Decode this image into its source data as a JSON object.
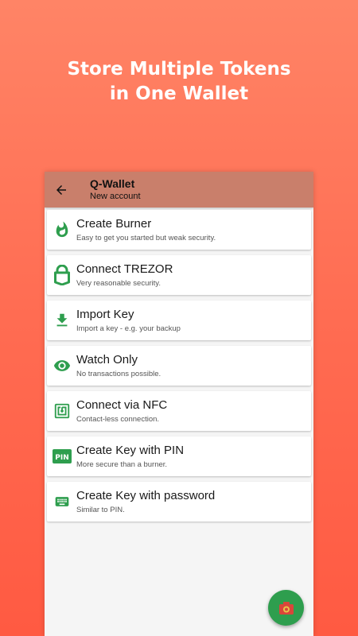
{
  "promo": {
    "line1": "Store Multiple Tokens",
    "line2": "in One Wallet"
  },
  "appbar": {
    "title": "Q-Wallet",
    "subtitle": "New account"
  },
  "accent_color": "#2e9e4e",
  "options": [
    {
      "title": "Create Burner",
      "description": "Easy to get you started but weak security.",
      "icon": "flame-icon"
    },
    {
      "title": "Connect TREZOR",
      "description": "Very reasonable security.",
      "icon": "trezor-lock-icon"
    },
    {
      "title": "Import Key",
      "description": "Import a key - e.g. your backup",
      "icon": "download-icon"
    },
    {
      "title": "Watch Only",
      "description": "No transactions possible.",
      "icon": "eye-icon"
    },
    {
      "title": "Connect via NFC",
      "description": "Contact-less connection.",
      "icon": "nfc-icon"
    },
    {
      "title": "Create Key with PIN",
      "description": "More secure than a burner.",
      "icon": "pin-icon"
    },
    {
      "title": "Create Key with password",
      "description": "Similar to PIN.",
      "icon": "keyboard-icon"
    }
  ],
  "fab": {
    "icon": "camera-icon"
  }
}
